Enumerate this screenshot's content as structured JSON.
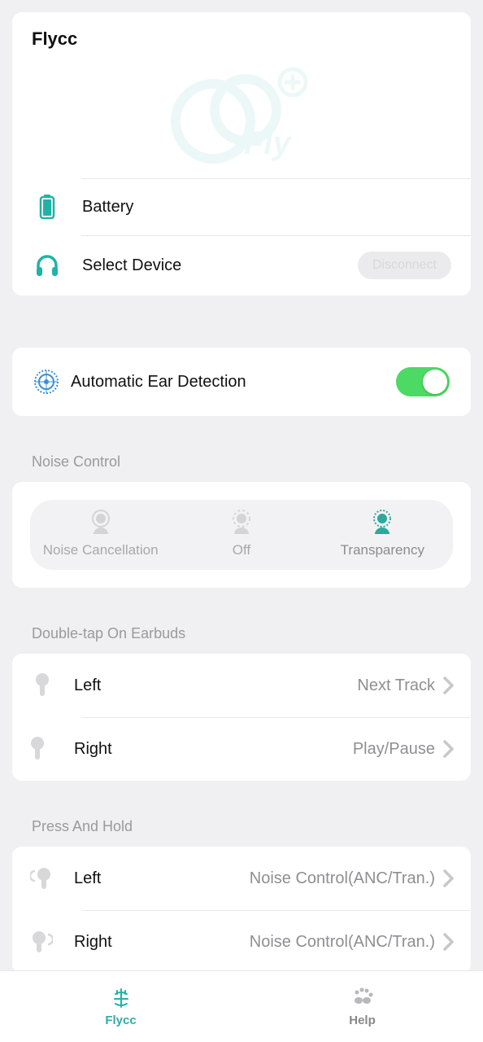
{
  "app": {
    "title": "Flycc"
  },
  "header": {
    "battery_label": "Battery",
    "select_device_label": "Select Device",
    "disconnect_label": "Disconnect"
  },
  "aed": {
    "label": "Automatic Ear Detection",
    "enabled": true
  },
  "noise": {
    "section_label": "Noise Control",
    "options": [
      {
        "label": "Noise Cancellation",
        "active": false
      },
      {
        "label": "Off",
        "active": false
      },
      {
        "label": "Transparency",
        "active": true
      }
    ]
  },
  "double_tap": {
    "section_label": "Double-tap On Earbuds",
    "left": {
      "label": "Left",
      "value": "Next Track"
    },
    "right": {
      "label": "Right",
      "value": "Play/Pause"
    }
  },
  "press_hold": {
    "section_label": "Press And Hold",
    "left": {
      "label": "Left",
      "value": "Noise Control(ANC/Tran.)"
    },
    "right": {
      "label": "Right",
      "value": "Noise Control(ANC/Tran.)"
    }
  },
  "tabs": {
    "flycc": "Flycc",
    "help": "Help"
  },
  "colors": {
    "accent": "#1fb3a6",
    "toggle_on": "#4cd964"
  }
}
